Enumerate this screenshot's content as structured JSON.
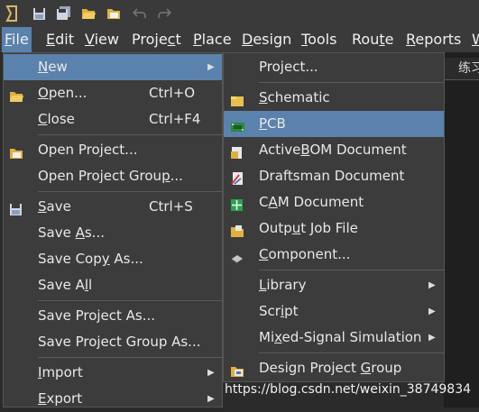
{
  "toolbar": {
    "icons": [
      "app-logo-icon",
      "save-icon",
      "save-all-icon",
      "open-folder-icon",
      "open-project-icon",
      "undo-icon",
      "redo-icon"
    ]
  },
  "menubar": {
    "items": [
      {
        "pre": "",
        "u": "F",
        "post": "ile"
      },
      {
        "pre": "",
        "u": "E",
        "post": "dit"
      },
      {
        "pre": "",
        "u": "V",
        "post": "iew"
      },
      {
        "pre": "Proje",
        "u": "c",
        "post": "t"
      },
      {
        "pre": "",
        "u": "P",
        "post": "lace"
      },
      {
        "pre": "",
        "u": "D",
        "post": "esign"
      },
      {
        "pre": "",
        "u": "T",
        "post": "ools"
      },
      {
        "pre": "Rou",
        "u": "t",
        "post": "e"
      },
      {
        "pre": "",
        "u": "R",
        "post": "eports"
      },
      {
        "pre": "",
        "u": "W",
        "post": ""
      }
    ]
  },
  "file_menu": {
    "items": [
      {
        "pre": "",
        "u": "N",
        "post": "ew",
        "shortcut": ""
      },
      {
        "pre": "",
        "u": "O",
        "post": "pen...",
        "shortcut": "Ctrl+O"
      },
      {
        "pre": "",
        "u": "C",
        "post": "lose",
        "shortcut": "Ctrl+F4"
      },
      {
        "pre": "Open Pro",
        "u": "j",
        "post": "ect...",
        "shortcut": ""
      },
      {
        "pre": "Open Project Grou",
        "u": "p",
        "post": "...",
        "shortcut": ""
      },
      {
        "pre": "",
        "u": "S",
        "post": "ave",
        "shortcut": "Ctrl+S"
      },
      {
        "pre": "Save ",
        "u": "A",
        "post": "s...",
        "shortcut": ""
      },
      {
        "pre": "Save Cop",
        "u": "y",
        "post": " As...",
        "shortcut": ""
      },
      {
        "pre": "Save A",
        "u": "l",
        "post": "l",
        "shortcut": ""
      },
      {
        "pre": "Save Project As...",
        "u": "",
        "post": "",
        "shortcut": ""
      },
      {
        "pre": "Save Project Group As...",
        "u": "",
        "post": "",
        "shortcut": ""
      },
      {
        "pre": "",
        "u": "I",
        "post": "mport",
        "shortcut": ""
      },
      {
        "pre": "",
        "u": "E",
        "post": "xport",
        "shortcut": ""
      }
    ]
  },
  "new_submenu": {
    "items": [
      {
        "pre": "Project...",
        "u": "",
        "post": ""
      },
      {
        "pre": "",
        "u": "S",
        "post": "chematic"
      },
      {
        "pre": "",
        "u": "P",
        "post": "CB"
      },
      {
        "pre": "Active",
        "u": "B",
        "post": "OM Document"
      },
      {
        "pre": "Draftsman Document",
        "u": "",
        "post": ""
      },
      {
        "pre": "C",
        "u": "A",
        "post": "M Document"
      },
      {
        "pre": "Outp",
        "u": "u",
        "post": "t Job File"
      },
      {
        "pre": "",
        "u": "C",
        "post": "omponent..."
      },
      {
        "pre": "",
        "u": "L",
        "post": "ibrary"
      },
      {
        "pre": "Scr",
        "u": "i",
        "post": "pt"
      },
      {
        "pre": "Mi",
        "u": "x",
        "post": "ed-Signal Simulation"
      },
      {
        "pre": "Design Project ",
        "u": "G",
        "post": "roup"
      }
    ]
  },
  "right_tab": {
    "label": "练习"
  },
  "watermark": "https://blog.csdn.net/weixin_38749834",
  "colors": {
    "highlight": "#5a82ad",
    "menu_bg": "#3c3c3c",
    "bar_bg": "#3a3a3a"
  }
}
